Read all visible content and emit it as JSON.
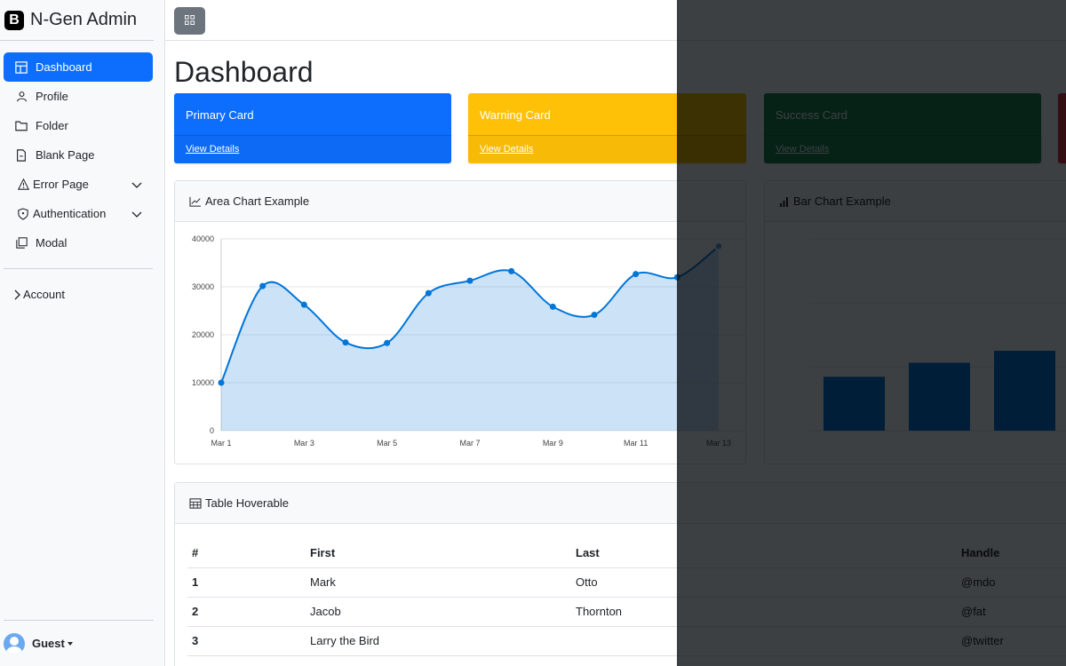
{
  "brand": {
    "logo_letter": "B",
    "name": "N-Gen Admin"
  },
  "sidebar": {
    "items": [
      {
        "label": "Dashboard",
        "icon": "layout-icon",
        "active": true
      },
      {
        "label": "Profile",
        "icon": "person-icon"
      },
      {
        "label": "Folder",
        "icon": "folder-icon"
      },
      {
        "label": "Blank Page",
        "icon": "file-icon"
      },
      {
        "label": "Error Page",
        "icon": "warning-icon",
        "expandable": true
      },
      {
        "label": "Authentication",
        "icon": "shield-icon",
        "expandable": true
      },
      {
        "label": "Modal",
        "icon": "copy-icon"
      }
    ],
    "account_label": "Account",
    "user_name": "Guest"
  },
  "page": {
    "title": "Dashboard"
  },
  "cards": [
    {
      "title": "Primary Card",
      "link": "View Details",
      "color": "#0d6efd"
    },
    {
      "title": "Warning Card",
      "link": "View Details",
      "color": "#ffc107"
    },
    {
      "title": "Success Card",
      "link": "View Details",
      "color": "#198754"
    }
  ],
  "area_chart": {
    "heading": "Area Chart Example",
    "chart_data": {
      "type": "area",
      "x": [
        "Mar 1",
        "Mar 2",
        "Mar 3",
        "Mar 4",
        "Mar 5",
        "Mar 6",
        "Mar 7",
        "Mar 8",
        "Mar 9",
        "Mar 10",
        "Mar 11",
        "Mar 12",
        "Mar 13"
      ],
      "tick_labels": [
        "Mar 1",
        "Mar 3",
        "Mar 5",
        "Mar 7",
        "Mar 9",
        "Mar 11",
        "Mar 13"
      ],
      "values": [
        10000,
        30162,
        26263,
        18394,
        18287,
        28682,
        31274,
        33259,
        25849,
        24159,
        32651,
        31984,
        38451
      ],
      "ylim": [
        0,
        40000
      ],
      "yticks": [
        0,
        10000,
        20000,
        30000,
        40000
      ],
      "grid": true
    }
  },
  "bar_chart": {
    "heading": "Bar Chart Example",
    "chart_data": {
      "type": "bar",
      "values": [
        4215,
        5312,
        6251
      ],
      "ylim": [
        0,
        15000
      ],
      "yticks": [
        0,
        5000,
        10000,
        15000
      ],
      "color": "#0275d8"
    }
  },
  "table": {
    "heading": "Table Hoverable",
    "columns": [
      "#",
      "First",
      "Last",
      "Handle"
    ],
    "rows": [
      [
        "1",
        "Mark",
        "Otto",
        "@mdo"
      ],
      [
        "2",
        "Jacob",
        "Thornton",
        "@fat"
      ],
      [
        "3",
        "Larry the Bird",
        "",
        "@twitter"
      ]
    ]
  }
}
